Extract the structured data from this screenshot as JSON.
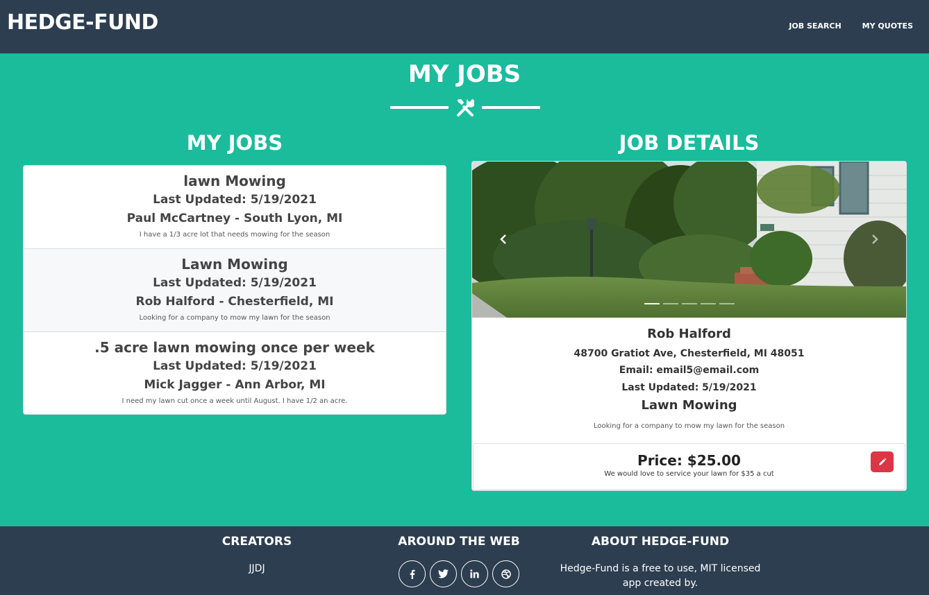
{
  "navbar": {
    "brand": "HEDGE-FUND",
    "links": [
      "JOB SEARCH",
      "MY QUOTES"
    ]
  },
  "masthead": {
    "title": "MY JOBS",
    "divider_icon": "tools-icon"
  },
  "jobs_panel": {
    "title": "MY JOBS",
    "items": [
      {
        "title": "lawn Mowing",
        "updated": "Last Updated: 5/19/2021",
        "person": "Paul McCartney - South Lyon, MI",
        "description": "I have a 1/3 acre lot that needs mowing for the season"
      },
      {
        "title": "Lawn Mowing",
        "updated": "Last Updated: 5/19/2021",
        "person": "Rob Halford - Chesterfield, MI",
        "description": "Looking for a company to mow my lawn for the season"
      },
      {
        "title": ".5 acre lawn mowing once per week",
        "updated": "Last Updated: 5/19/2021",
        "person": "Mick Jagger - Ann Arbor, MI",
        "description": "I need my lawn cut once a week until August. I have 1/2 an acre."
      }
    ],
    "selected_index": 1
  },
  "details_panel": {
    "title": "JOB DETAILS",
    "carousel": {
      "slide_count": 5,
      "active_slide": 1
    },
    "name": "Rob Halford",
    "address": "48700 Gratiot Ave, Chesterfield, MI 48051",
    "email": "Email: email5@email.com",
    "updated": "Last Updated: 5/19/2021",
    "job_title": "Lawn Mowing",
    "description": "Looking for a company to mow my lawn for the season",
    "quote": {
      "price": "Price: $25.00",
      "message": "We would love to service your lawn for $35 a cut",
      "edit_icon": "pencil-icon"
    }
  },
  "footer": {
    "creators": {
      "title": "CREATORS",
      "text": "JJDJ"
    },
    "around": {
      "title": "AROUND THE WEB",
      "icons": [
        "facebook-icon",
        "twitter-icon",
        "linkedin-icon",
        "dribbble-icon"
      ]
    },
    "about": {
      "title": "ABOUT HEDGE-FUND",
      "text": "Hedge-Fund is a free to use, MIT licensed app created by."
    }
  },
  "colors": {
    "teal": "#1abc9c",
    "navy": "#2c3e50",
    "danger": "#dc3545"
  }
}
